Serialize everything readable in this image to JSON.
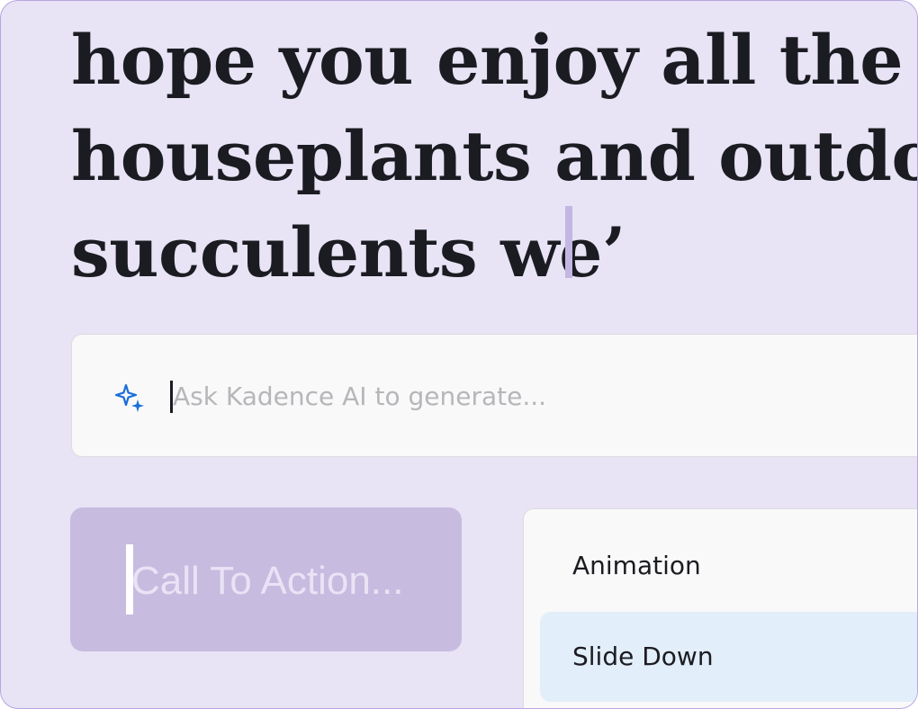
{
  "editor": {
    "headline_lines": [
      "hope you enjoy all the new",
      "houseplants and outdoor",
      "succulents we’"
    ]
  },
  "ai_prompt": {
    "icon": "sparkles-icon",
    "placeholder": "Ask Kadence AI to generate...",
    "value": ""
  },
  "cta": {
    "placeholder": "Call To Action...",
    "value": ""
  },
  "animation_menu": {
    "label": "Animation",
    "options": [
      {
        "label": "Slide Down",
        "selected": true
      }
    ]
  },
  "colors": {
    "background": "#e8e3f5",
    "cta_background": "#c7bbe0",
    "selection_highlight": "#e2eef9",
    "sparkle_accent": "#1a6fd9",
    "text": "#1b1c22"
  }
}
